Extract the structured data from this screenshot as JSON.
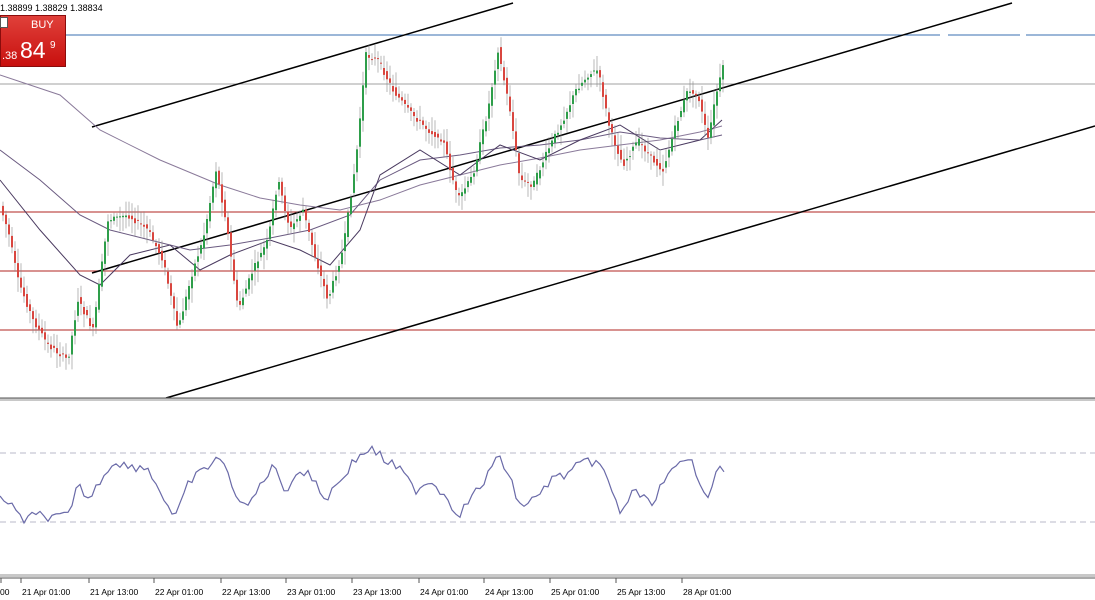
{
  "ohlc_text": "1.38899 1.38829 1.38834",
  "trade_panel": {
    "buy_label": "BUY",
    "price_small": ".38",
    "price_big": "84",
    "price_sup": "9"
  },
  "x_axis_labels": [
    "00",
    "21 Apr 01:00",
    "21 Apr 13:00",
    "22 Apr 01:00",
    "22 Apr 13:00",
    "23 Apr 01:00",
    "23 Apr 13:00",
    "24 Apr 01:00",
    "24 Apr 13:00",
    "25 Apr 01:00",
    "25 Apr 13:00",
    "28 Apr 01:00"
  ],
  "colors": {
    "bull_candle": "#2e9e4a",
    "bear_candle": "#d9463f",
    "support_line": "#c0504d",
    "resistance_line": "#3a6fb0",
    "channel_line": "#000000",
    "moving_average": "#5a4a70",
    "oscillator": "#6a6aa8"
  }
}
